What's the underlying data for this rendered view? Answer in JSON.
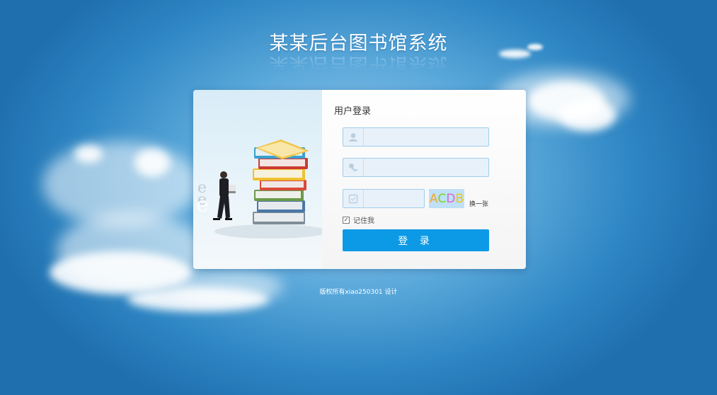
{
  "header": {
    "title": "某某后台图书馆系统"
  },
  "login": {
    "heading": "用户登录",
    "username": {
      "value": "",
      "placeholder": "",
      "icon": "user-icon"
    },
    "password": {
      "value": "",
      "placeholder": "",
      "icon": "key-icon"
    },
    "verify_code": {
      "value": "",
      "placeholder": "",
      "icon": "code-icon"
    },
    "captcha": {
      "text": "ACDB",
      "colors": [
        "#f5a623",
        "#7ed321",
        "#d968c9",
        "#f1c40f"
      ]
    },
    "refresh_label": "换一张",
    "remember_label": "记住我",
    "remember_checked": true,
    "submit_label": "登 录"
  },
  "footer": {
    "copyright": "版权所有xiao250301 设计"
  },
  "colors": {
    "accent": "#0c9ae6",
    "field_border": "#9fcfee",
    "field_bg": "#e8f1fa"
  }
}
